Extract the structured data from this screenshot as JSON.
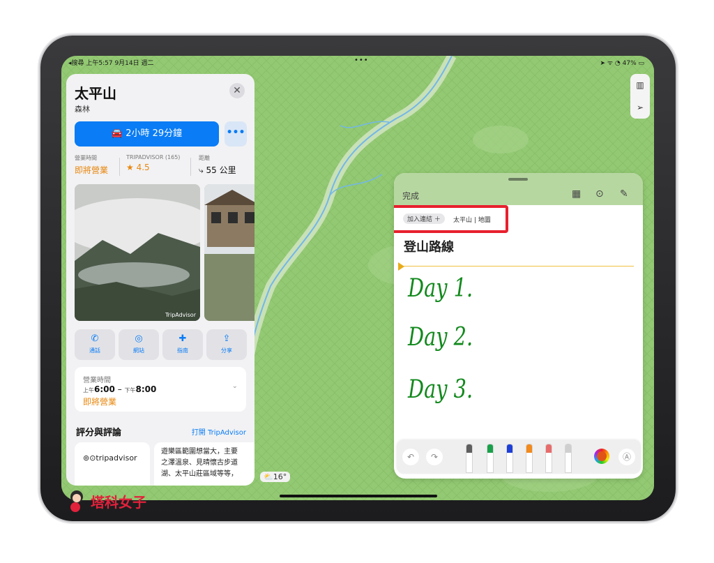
{
  "status_bar": {
    "left": "◂搜尋  上午5:57   9月14日 週二",
    "center_dots": "•••",
    "right": "➤ ᯤ ◔ 47% ▭"
  },
  "place_card": {
    "title": "太平山",
    "subtitle": "森林",
    "close_icon": "✕",
    "drive_button": "2小時 29分鐘",
    "more_button": "•••",
    "hours_label": "營業時間",
    "hours_value": "即將營業",
    "tripadvisor_label": "TRIPADVISOR (165)",
    "tripadvisor_rating": "★ 4.5",
    "distance_label": "距離",
    "distance_value": "55 公里",
    "photo_credit": "TripAdvisor",
    "actions": [
      {
        "icon": "phone-icon",
        "glyph": "✆",
        "label": "通話"
      },
      {
        "icon": "compass-icon",
        "glyph": "◎",
        "label": "網站"
      },
      {
        "icon": "plus-icon",
        "glyph": "✚",
        "label": "指南"
      },
      {
        "icon": "share-icon",
        "glyph": "⇪",
        "label": "分享"
      }
    ],
    "hours_section": {
      "title": "營業時間",
      "am_label": "上午",
      "open_time": "6:00",
      "dash": "–",
      "pm_label": "下午",
      "close_time": "8:00",
      "status": "即將營業",
      "chevron": "⌄"
    },
    "reviews_title": "評分與評論",
    "reviews_link": "打開 TripAdvisor",
    "tripadvisor_logo": "⊚⊙tripadvisor",
    "review_lines": [
      "遊樂區範圍想當大，主要",
      "之澤溫泉、見晴懷古步道",
      "湖、太平山莊區域等等，"
    ]
  },
  "weather": "⛅16°",
  "map_controls": {
    "map_icon": "▥",
    "location_icon": "➢"
  },
  "note": {
    "done_label": "完成",
    "grid_icon": "▦",
    "more_icon": "⊙",
    "compose_icon": "✎",
    "add_link_chip": "加入連結  ＋",
    "link_text": "太平山 | 地圖",
    "title": "登山路線",
    "handwritten": [
      "Day 1.",
      "Day 2.",
      "Day 3."
    ],
    "undo_icon": "↶",
    "redo_icon": "↷",
    "markup_icon": "Ⓐ",
    "pen_colors": [
      "#5e5e5e",
      "#1aa04a",
      "#1d3fd6",
      "#f28a1c",
      "#e86b6b",
      "#cfcfcf"
    ]
  },
  "watermark": "塔科女子"
}
